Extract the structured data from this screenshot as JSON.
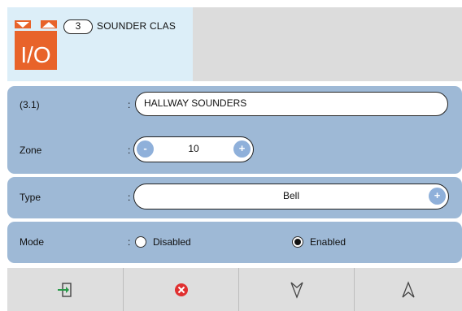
{
  "header": {
    "class_number": "3",
    "class_title": "SOUNDER CLAS",
    "icon_name": "io-module-icon",
    "icon_color": "#e8632a"
  },
  "fields": {
    "id_label": "(3.1)",
    "name_value": "HALLWAY SOUNDERS",
    "zone_label": "Zone",
    "zone_value": "10",
    "zone_minus": "-",
    "zone_plus": "+",
    "type_label": "Type",
    "type_value": "Bell",
    "type_plus": "+",
    "mode_label": "Mode",
    "mode_option_disabled": "Disabled",
    "mode_option_enabled": "Enabled",
    "mode_selected": "Enabled",
    "colon": ":"
  },
  "toolbar": {
    "buttons": [
      {
        "icon": "exit-icon"
      },
      {
        "icon": "cancel-icon"
      },
      {
        "icon": "next-down-icon"
      },
      {
        "icon": "previous-up-icon"
      }
    ]
  },
  "colors": {
    "panel": "#9eb9d6",
    "header_left_bg": "#dceef8",
    "header_right_bg": "#dcdcdc",
    "button_accent": "#8fb0da",
    "cancel_red": "#e03030",
    "exit_green": "#2a9a4a"
  }
}
